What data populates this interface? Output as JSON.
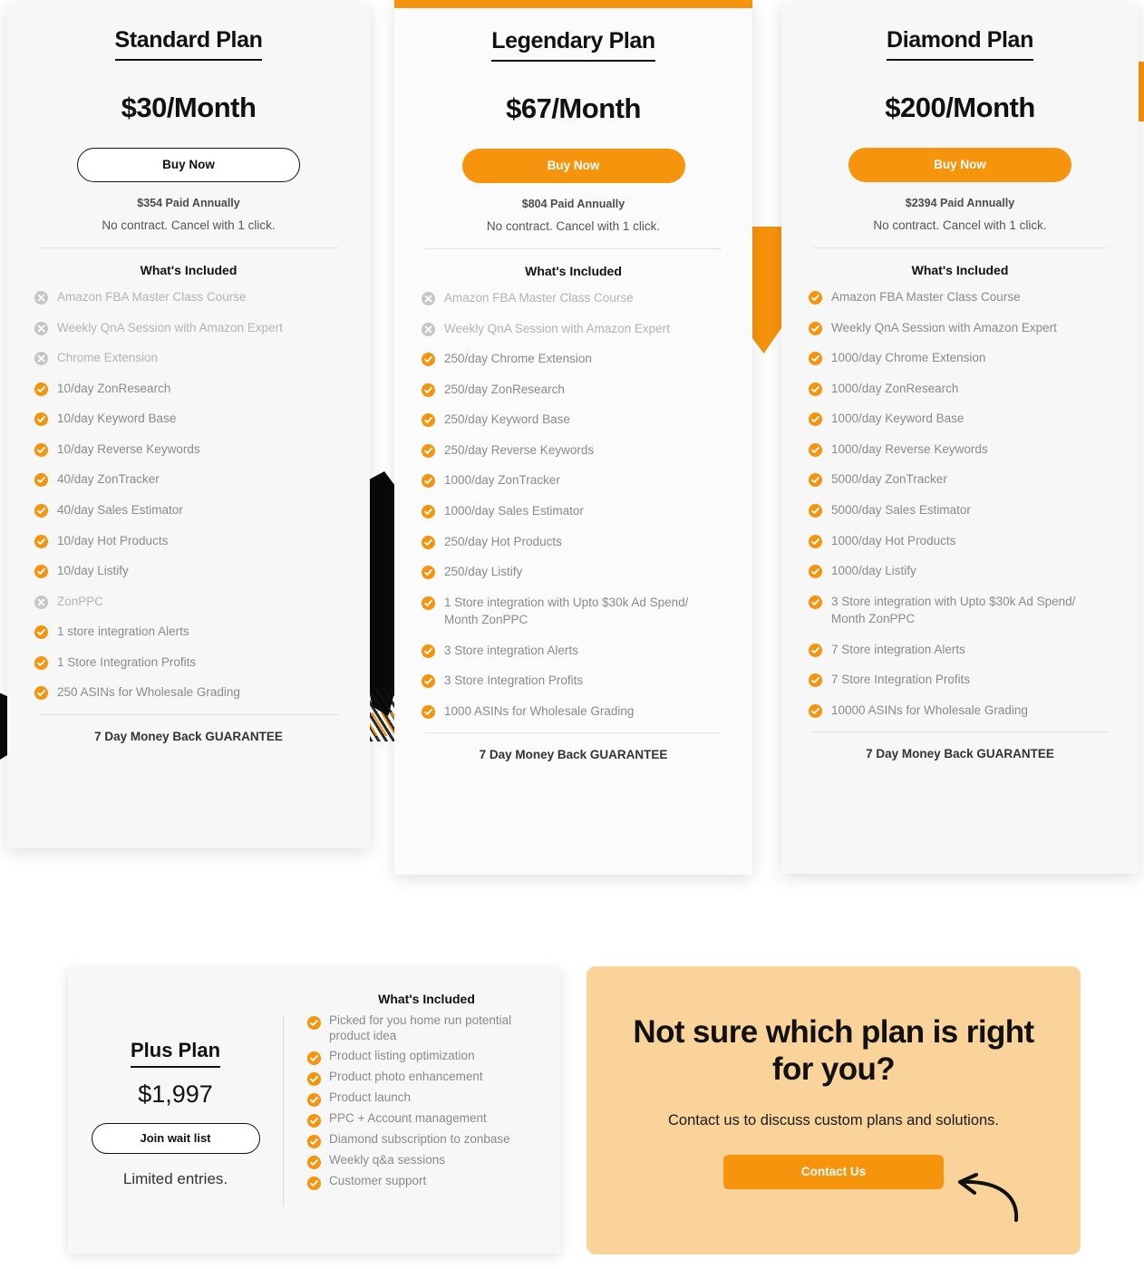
{
  "common": {
    "whats_included": "What's Included",
    "no_contract": "No contract. Cancel with 1 click.",
    "guarantee": "7 Day Money Back GUARANTEE",
    "buy_now": "Buy Now",
    "accent_color": "#F7940D",
    "card_bg": "#f7f7f7",
    "cta_bg": "#FAD39A",
    "icon_check": "check-circle-icon",
    "icon_cross": "cross-circle-icon"
  },
  "plans": [
    {
      "name": "Standard Plan",
      "price": "$30/Month",
      "annual": "$354 Paid Annually",
      "cta": "Buy Now",
      "features": [
        {
          "label": "Amazon FBA Master Class Course",
          "included": false
        },
        {
          "label": "Weekly QnA Session with Amazon Expert",
          "included": false
        },
        {
          "label": "Chrome Extension",
          "included": false
        },
        {
          "label": "10/day ZonResearch",
          "included": true
        },
        {
          "label": "10/day Keyword Base",
          "included": true
        },
        {
          "label": "10/day Reverse Keywords",
          "included": true
        },
        {
          "label": "40/day ZonTracker",
          "included": true
        },
        {
          "label": "40/day Sales Estimator",
          "included": true
        },
        {
          "label": "10/day Hot Products",
          "included": true
        },
        {
          "label": "10/day Listify",
          "included": true
        },
        {
          "label": "ZonPPC",
          "included": false
        },
        {
          "label": "1 store integration Alerts",
          "included": true
        },
        {
          "label": "1 Store Integration Profits",
          "included": true
        },
        {
          "label": "250 ASINs for Wholesale Grading",
          "included": true
        }
      ]
    },
    {
      "name": "Legendary Plan",
      "price": "$67/Month",
      "annual": "$804 Paid Annually",
      "cta": "Buy Now",
      "features": [
        {
          "label": "Amazon FBA Master Class Course",
          "included": false
        },
        {
          "label": "Weekly QnA Session with Amazon Expert",
          "included": false
        },
        {
          "label": "250/day Chrome Extension",
          "included": true
        },
        {
          "label": "250/day ZonResearch",
          "included": true
        },
        {
          "label": "250/day Keyword Base",
          "included": true
        },
        {
          "label": "250/day Reverse Keywords",
          "included": true
        },
        {
          "label": "1000/day ZonTracker",
          "included": true
        },
        {
          "label": "1000/day Sales Estimator",
          "included": true
        },
        {
          "label": "250/day Hot Products",
          "included": true
        },
        {
          "label": "250/day Listify",
          "included": true
        },
        {
          "label": "1 Store integration with Upto $30k Ad Spend/ Month ZonPPC",
          "included": true
        },
        {
          "label": "3 Store integration Alerts",
          "included": true
        },
        {
          "label": "3 Store Integration Profits",
          "included": true
        },
        {
          "label": "1000 ASINs for Wholesale Grading",
          "included": true
        }
      ]
    },
    {
      "name": "Diamond Plan",
      "price": "$200/Month",
      "annual": "$2394 Paid Annually",
      "cta": "Buy Now",
      "features": [
        {
          "label": "Amazon FBA Master Class Course",
          "included": true
        },
        {
          "label": "Weekly QnA Session with Amazon Expert",
          "included": true
        },
        {
          "label": "1000/day Chrome Extension",
          "included": true
        },
        {
          "label": "1000/day ZonResearch",
          "included": true
        },
        {
          "label": "1000/day Keyword Base",
          "included": true
        },
        {
          "label": "1000/day Reverse Keywords",
          "included": true
        },
        {
          "label": "5000/day ZonTracker",
          "included": true
        },
        {
          "label": "5000/day Sales Estimator",
          "included": true
        },
        {
          "label": "1000/day Hot Products",
          "included": true
        },
        {
          "label": "1000/day Listify",
          "included": true
        },
        {
          "label": "3 Store integration with Upto $30k Ad Spend/ Month ZonPPC",
          "included": true
        },
        {
          "label": "7 Store integration Alerts",
          "included": true
        },
        {
          "label": "7 Store Integration Profits",
          "included": true
        },
        {
          "label": "10000 ASINs for Wholesale Grading",
          "included": true
        }
      ]
    }
  ],
  "plus_plan": {
    "name": "Plus Plan",
    "price": "$1,997",
    "cta": "Join wait list",
    "note": "Limited entries.",
    "whats_included": "What's Included",
    "features": [
      {
        "label": "Picked for you home run potential product idea",
        "included": true
      },
      {
        "label": "Product listing optimization",
        "included": true
      },
      {
        "label": "Product photo enhancement",
        "included": true
      },
      {
        "label": "Product launch",
        "included": true
      },
      {
        "label": "PPC + Account management",
        "included": true
      },
      {
        "label": "Diamond subscription to zonbase",
        "included": true
      },
      {
        "label": "Weekly q&a sessions",
        "included": true
      },
      {
        "label": "Customer support",
        "included": true
      }
    ]
  },
  "contact_cta": {
    "title": "Not sure which plan is right for you?",
    "subtitle": "Contact us to discuss custom plans and solutions.",
    "button": "Contact Us",
    "arrow_icon": "curved-arrow-icon"
  }
}
